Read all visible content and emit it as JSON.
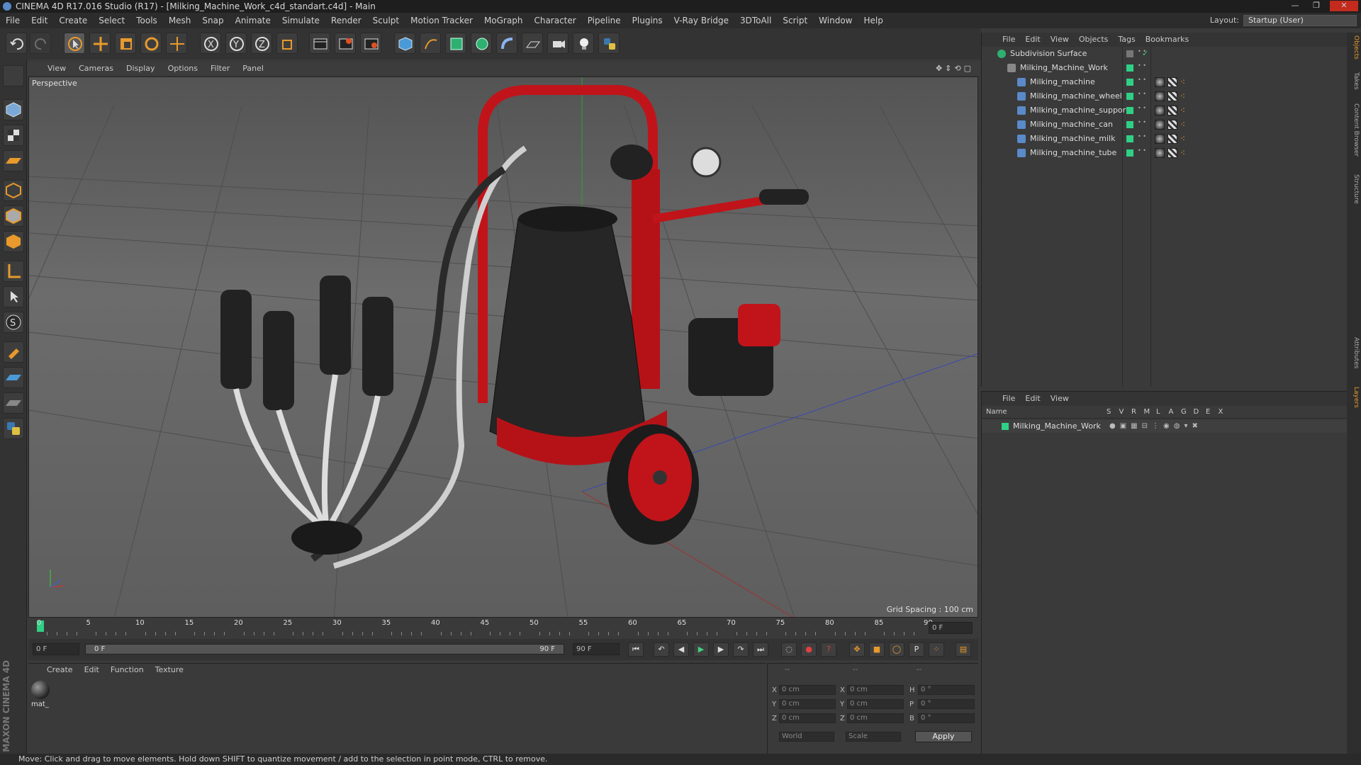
{
  "titlebar": {
    "title": "CINEMA 4D R17.016 Studio (R17) - [Milking_Machine_Work_c4d_standart.c4d] - Main"
  },
  "menu": [
    "File",
    "Edit",
    "Create",
    "Select",
    "Tools",
    "Mesh",
    "Snap",
    "Animate",
    "Simulate",
    "Render",
    "Sculpt",
    "Motion Tracker",
    "MoGraph",
    "Character",
    "Pipeline",
    "Plugins",
    "V-Ray Bridge",
    "3DToAll",
    "Script",
    "Window",
    "Help"
  ],
  "layout": {
    "label": "Layout:",
    "value": "Startup (User)"
  },
  "viewport": {
    "menu": [
      "View",
      "Cameras",
      "Display",
      "Options",
      "Filter",
      "Panel"
    ],
    "label": "Perspective",
    "grid_spacing": "Grid Spacing : 100 cm"
  },
  "timeline": {
    "ticks": [
      "0",
      "5",
      "10",
      "15",
      "20",
      "25",
      "30",
      "35",
      "40",
      "45",
      "50",
      "55",
      "60",
      "65",
      "70",
      "75",
      "80",
      "85",
      "90"
    ],
    "current_frame": "0 F",
    "start_field": "0 F",
    "range_start": "0 F",
    "range_end": "90 F",
    "end_field": "90 F"
  },
  "material_panel": {
    "menu": [
      "Create",
      "Edit",
      "Function",
      "Texture"
    ],
    "material_name": "mat_"
  },
  "coord_panel": {
    "headers": [
      "--",
      "--",
      "--"
    ],
    "rows": [
      {
        "a": "X",
        "av": "0 cm",
        "b": "X",
        "bv": "0 cm",
        "c": "H",
        "cv": "0 °"
      },
      {
        "a": "Y",
        "av": "0 cm",
        "b": "Y",
        "bv": "0 cm",
        "c": "P",
        "cv": "0 °"
      },
      {
        "a": "Z",
        "av": "0 cm",
        "b": "Z",
        "bv": "0 cm",
        "c": "B",
        "cv": "0 °"
      }
    ],
    "world": "World",
    "scale": "Scale",
    "apply": "Apply"
  },
  "objects_panel": {
    "menu": [
      "File",
      "Edit",
      "View",
      "Objects",
      "Tags",
      "Bookmarks"
    ],
    "items": [
      {
        "name": "Subdivision Surface",
        "indent": 0
      },
      {
        "name": "Milking_Machine_Work",
        "indent": 1
      },
      {
        "name": "Milking_machine",
        "indent": 2
      },
      {
        "name": "Milking_machine_wheel",
        "indent": 2
      },
      {
        "name": "Milking_machine_support",
        "indent": 2
      },
      {
        "name": "Milking_machine_can",
        "indent": 2
      },
      {
        "name": "Milking_machine_milk",
        "indent": 2
      },
      {
        "name": "Milking_machine_tube",
        "indent": 2
      }
    ]
  },
  "layers_panel": {
    "menu": [
      "File",
      "Edit",
      "View"
    ],
    "columns": [
      "Name",
      "S",
      "V",
      "R",
      "M",
      "L",
      "A",
      "G",
      "D",
      "E",
      "X"
    ],
    "rows": [
      "Milking_Machine_Work"
    ]
  },
  "right_tabs": [
    "Objects",
    "Takes",
    "Content Browser",
    "Structure",
    "Attributes",
    "Layers"
  ],
  "status": "Move: Click and drag to move elements. Hold down SHIFT to quantize movement / add to the selection in point mode, CTRL to remove.",
  "colors": {
    "accent_green": "#2fd085",
    "machine_red": "#c0141a",
    "accent_blue": "#5a8ac8"
  }
}
